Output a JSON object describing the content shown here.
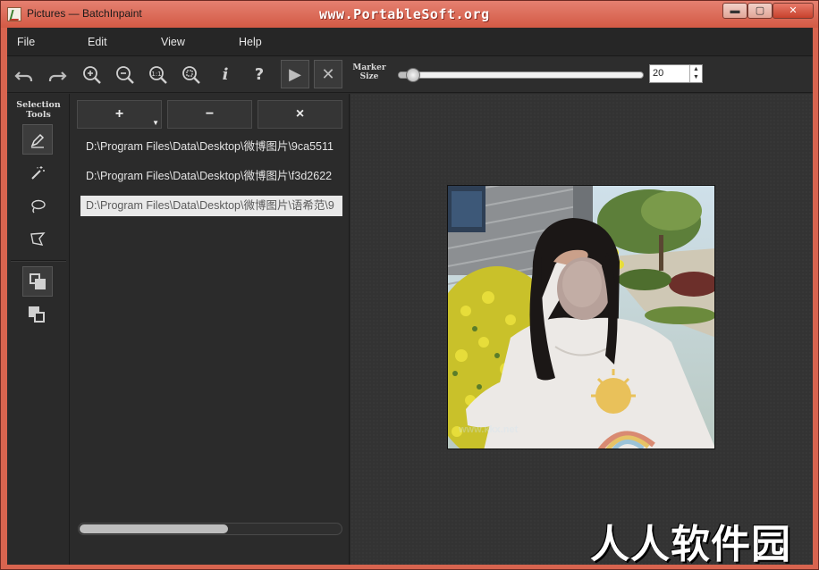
{
  "window": {
    "title": "Pictures — BatchInpaint",
    "banner": "www.PortableSoft.org",
    "controls": {
      "minimize": "▬",
      "maximize": "▢",
      "close": "✕"
    }
  },
  "menu": {
    "items": [
      {
        "label": "File"
      },
      {
        "label": "Edit"
      },
      {
        "label": "View"
      },
      {
        "label": "Help"
      }
    ]
  },
  "toolbar": {
    "icons": {
      "undo": "undo-icon",
      "redo": "redo-icon",
      "zoom_in": "zoom-in-icon",
      "zoom_out": "zoom-out-icon",
      "zoom_actual": "zoom-actual-size-icon",
      "zoom_fit": "zoom-fit-icon",
      "info": "info-icon",
      "help": "help-icon",
      "run": "play-icon",
      "cancel": "cancel-icon"
    },
    "marker_label": "Marker Size",
    "marker_value": "20",
    "marker_fraction": 0.06
  },
  "tools": {
    "label": "Selection Tools",
    "items": [
      {
        "icon": "marker-pen-icon",
        "active": true
      },
      {
        "icon": "magic-wand-icon",
        "active": false
      },
      {
        "icon": "lasso-icon",
        "active": false
      },
      {
        "icon": "polygon-lasso-icon",
        "active": false
      }
    ],
    "layer_modes": [
      {
        "icon": "layer-front-icon",
        "active": true
      },
      {
        "icon": "layer-back-icon",
        "active": false
      }
    ]
  },
  "file_list": {
    "add_label": "+",
    "remove_label": "−",
    "clear_label": "×",
    "files": [
      {
        "path": "D:\\Program Files\\Data\\Desktop\\微博图片\\9ca5511",
        "selected": false
      },
      {
        "path": "D:\\Program Files\\Data\\Desktop\\微博图片\\f3d2622",
        "selected": false
      },
      {
        "path": "D:\\Program Files\\Data\\Desktop\\微博图片\\语希范\\9",
        "selected": true
      }
    ]
  },
  "canvas": {
    "photo_watermark": "www.kkx.net"
  },
  "overlay": {
    "site_watermark": "人人软件园"
  },
  "colors": {
    "titlebar": "#d35a45",
    "panel_bg": "#2b2b2b",
    "canvas_bg": "#333333",
    "selection": "#e9e9e9"
  }
}
